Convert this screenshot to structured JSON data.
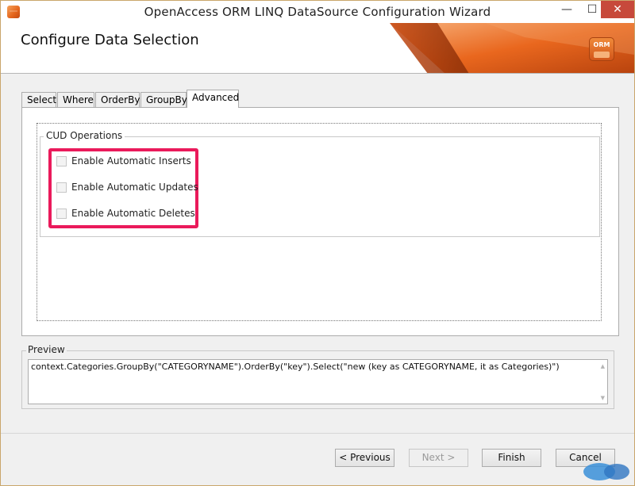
{
  "window": {
    "title": "OpenAccess ORM LINQ DataSource Configuration Wizard",
    "controls": {
      "minimize": "—",
      "maximize": "☐",
      "close": "✕"
    }
  },
  "header": {
    "title": "Configure Data Selection",
    "badge": "ORM"
  },
  "tabs": [
    {
      "label": "Select"
    },
    {
      "label": "Where"
    },
    {
      "label": "OrderBy"
    },
    {
      "label": "GroupBy"
    },
    {
      "label": "Advanced",
      "active": true
    }
  ],
  "cud": {
    "legend": "CUD Operations",
    "options": [
      {
        "label": "Enable Automatic Inserts",
        "checked": false,
        "enabled": false
      },
      {
        "label": "Enable Automatic Updates",
        "checked": false,
        "enabled": false
      },
      {
        "label": "Enable Automatic Deletes",
        "checked": false,
        "enabled": false
      }
    ],
    "highlight_color": "#ea1a5b"
  },
  "preview": {
    "legend": "Preview",
    "text": "context.Categories.GroupBy(\"CATEGORYNAME\").OrderBy(\"key\").Select(\"new (key as CATEGORYNAME, it as Categories)\")"
  },
  "buttons": {
    "previous": "< Previous",
    "next": "Next >",
    "finish": "Finish",
    "cancel": "Cancel"
  },
  "colors": {
    "accent_orange": "#e4651c",
    "close_button": "#c7493b"
  }
}
